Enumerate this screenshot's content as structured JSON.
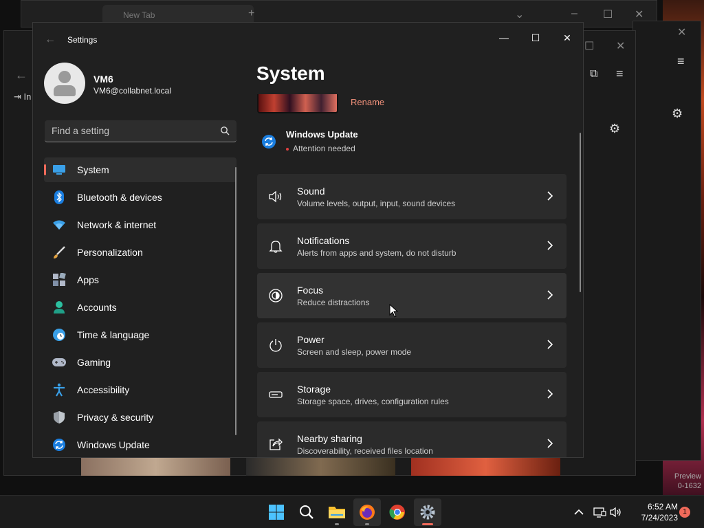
{
  "background": {
    "browser_tab_title": "New Tab",
    "preview_line1": "Preview",
    "preview_line2": "0-1632",
    "left_toolbar_text": "In"
  },
  "window": {
    "app_title": "Settings",
    "minimize": "—",
    "maximize": "☐",
    "close": "✕"
  },
  "profile": {
    "name": "VM6",
    "email": "VM6@collabnet.local"
  },
  "search": {
    "placeholder": "Find a setting"
  },
  "nav": {
    "items": [
      {
        "label": "System",
        "icon": "system-icon",
        "active": true
      },
      {
        "label": "Bluetooth & devices",
        "icon": "bluetooth-icon"
      },
      {
        "label": "Network & internet",
        "icon": "network-icon"
      },
      {
        "label": "Personalization",
        "icon": "personalization-icon"
      },
      {
        "label": "Apps",
        "icon": "apps-icon"
      },
      {
        "label": "Accounts",
        "icon": "accounts-icon"
      },
      {
        "label": "Time & language",
        "icon": "time-language-icon"
      },
      {
        "label": "Gaming",
        "icon": "gaming-icon"
      },
      {
        "label": "Accessibility",
        "icon": "accessibility-icon"
      },
      {
        "label": "Privacy & security",
        "icon": "privacy-icon"
      },
      {
        "label": "Windows Update",
        "icon": "windows-update-icon"
      }
    ]
  },
  "main": {
    "title": "System",
    "rename_label": "Rename",
    "windows_update": {
      "title": "Windows Update",
      "status": "Attention needed"
    },
    "cards": [
      {
        "title": "Sound",
        "subtitle": "Volume levels, output, input, sound devices",
        "icon": "sound-icon"
      },
      {
        "title": "Notifications",
        "subtitle": "Alerts from apps and system, do not disturb",
        "icon": "notifications-icon"
      },
      {
        "title": "Focus",
        "subtitle": "Reduce distractions",
        "icon": "focus-icon"
      },
      {
        "title": "Power",
        "subtitle": "Screen and sleep, power mode",
        "icon": "power-icon"
      },
      {
        "title": "Storage",
        "subtitle": "Storage space, drives, configuration rules",
        "icon": "storage-icon"
      },
      {
        "title": "Nearby sharing",
        "subtitle": "Discoverability, received files location",
        "icon": "nearby-sharing-icon"
      }
    ]
  },
  "taskbar": {
    "time": "6:52 AM",
    "date": "7/24/2023",
    "notification_count": "1",
    "apps": [
      "start",
      "search",
      "file-explorer",
      "firefox",
      "chrome",
      "settings"
    ]
  },
  "colors": {
    "accent": "#f06a5a",
    "window_bg": "#202020",
    "card_bg": "#2b2b2b"
  }
}
